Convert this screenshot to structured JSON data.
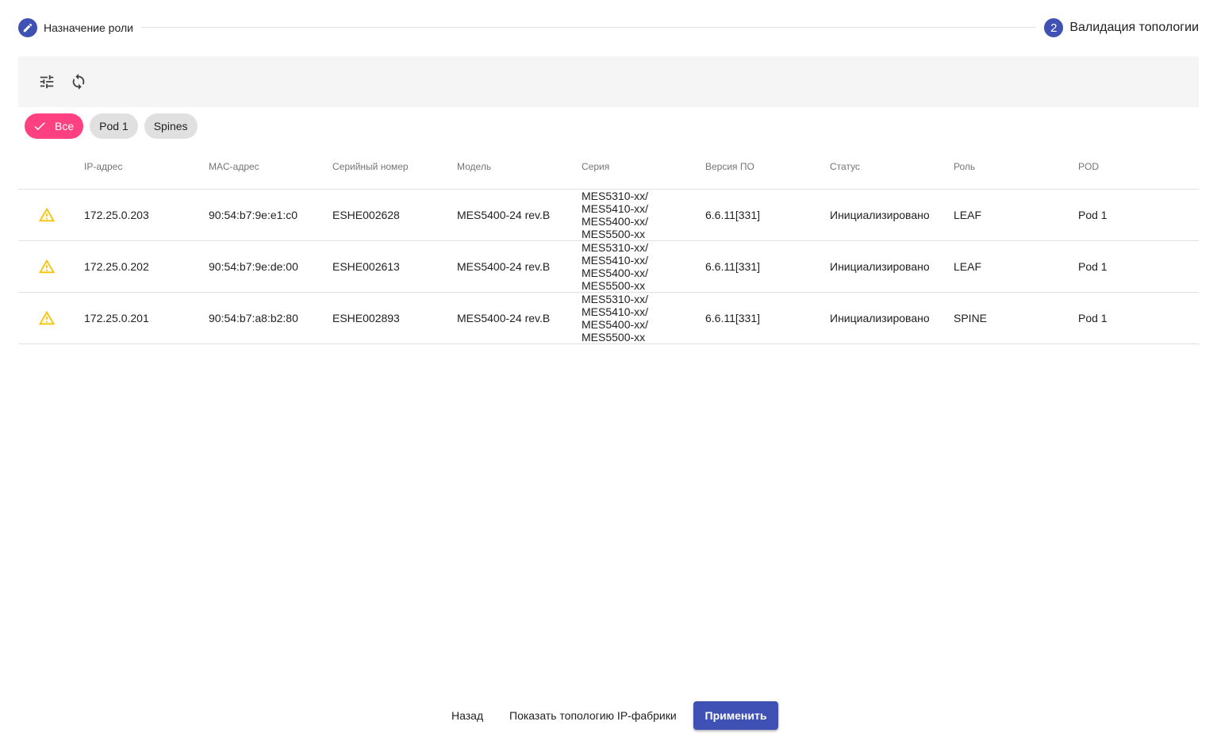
{
  "stepper": {
    "step1_label": "Назначение роли",
    "step2_number": "2",
    "step2_label": "Валидация топологии"
  },
  "toolbar": {
    "filter_icon": "tune-icon",
    "refresh_icon": "sync-icon"
  },
  "chips": [
    {
      "label": "Все",
      "selected": true
    },
    {
      "label": "Pod 1",
      "selected": false
    },
    {
      "label": "Spines",
      "selected": false
    }
  ],
  "table": {
    "headers": {
      "ip": "IP-адрес",
      "mac": "MAC-адрес",
      "serial": "Серийный номер",
      "model": "Модель",
      "series": "Серия",
      "firmware": "Версия ПО",
      "status": "Статус",
      "role": "Роль",
      "pod": "POD"
    },
    "rows": [
      {
        "icon": "warning-icon",
        "ip": "172.25.0.203",
        "mac": "90:54:b7:9e:e1:c0",
        "serial": "ESHE002628",
        "model": "MES5400-24 rev.B",
        "series": [
          "MES5310-xx/",
          "MES5410-xx/",
          "MES5400-xx/",
          "MES5500-xx"
        ],
        "firmware": "6.6.11[331]",
        "status": "Инициализировано",
        "role": "LEAF",
        "pod": "Pod 1"
      },
      {
        "icon": "warning-icon",
        "ip": "172.25.0.202",
        "mac": "90:54:b7:9e:de:00",
        "serial": "ESHE002613",
        "model": "MES5400-24 rev.B",
        "series": [
          "MES5310-xx/",
          "MES5410-xx/",
          "MES5400-xx/",
          "MES5500-xx"
        ],
        "firmware": "6.6.11[331]",
        "status": "Инициализировано",
        "role": "LEAF",
        "pod": "Pod 1"
      },
      {
        "icon": "warning-icon",
        "ip": "172.25.0.201",
        "mac": "90:54:b7:a8:b2:80",
        "serial": "ESHE002893",
        "model": "MES5400-24 rev.B",
        "series": [
          "MES5310-xx/",
          "MES5410-xx/",
          "MES5400-xx/",
          "MES5500-xx"
        ],
        "firmware": "6.6.11[331]",
        "status": "Инициализировано",
        "role": "SPINE",
        "pod": "Pod 1"
      }
    ]
  },
  "footer": {
    "back_label": "Назад",
    "topology_label": "Показать топологию IP-фабрики",
    "apply_label": "Применить"
  },
  "colors": {
    "primary": "#3f51b5",
    "accent": "#ff4081",
    "warning": "#f9c200"
  }
}
